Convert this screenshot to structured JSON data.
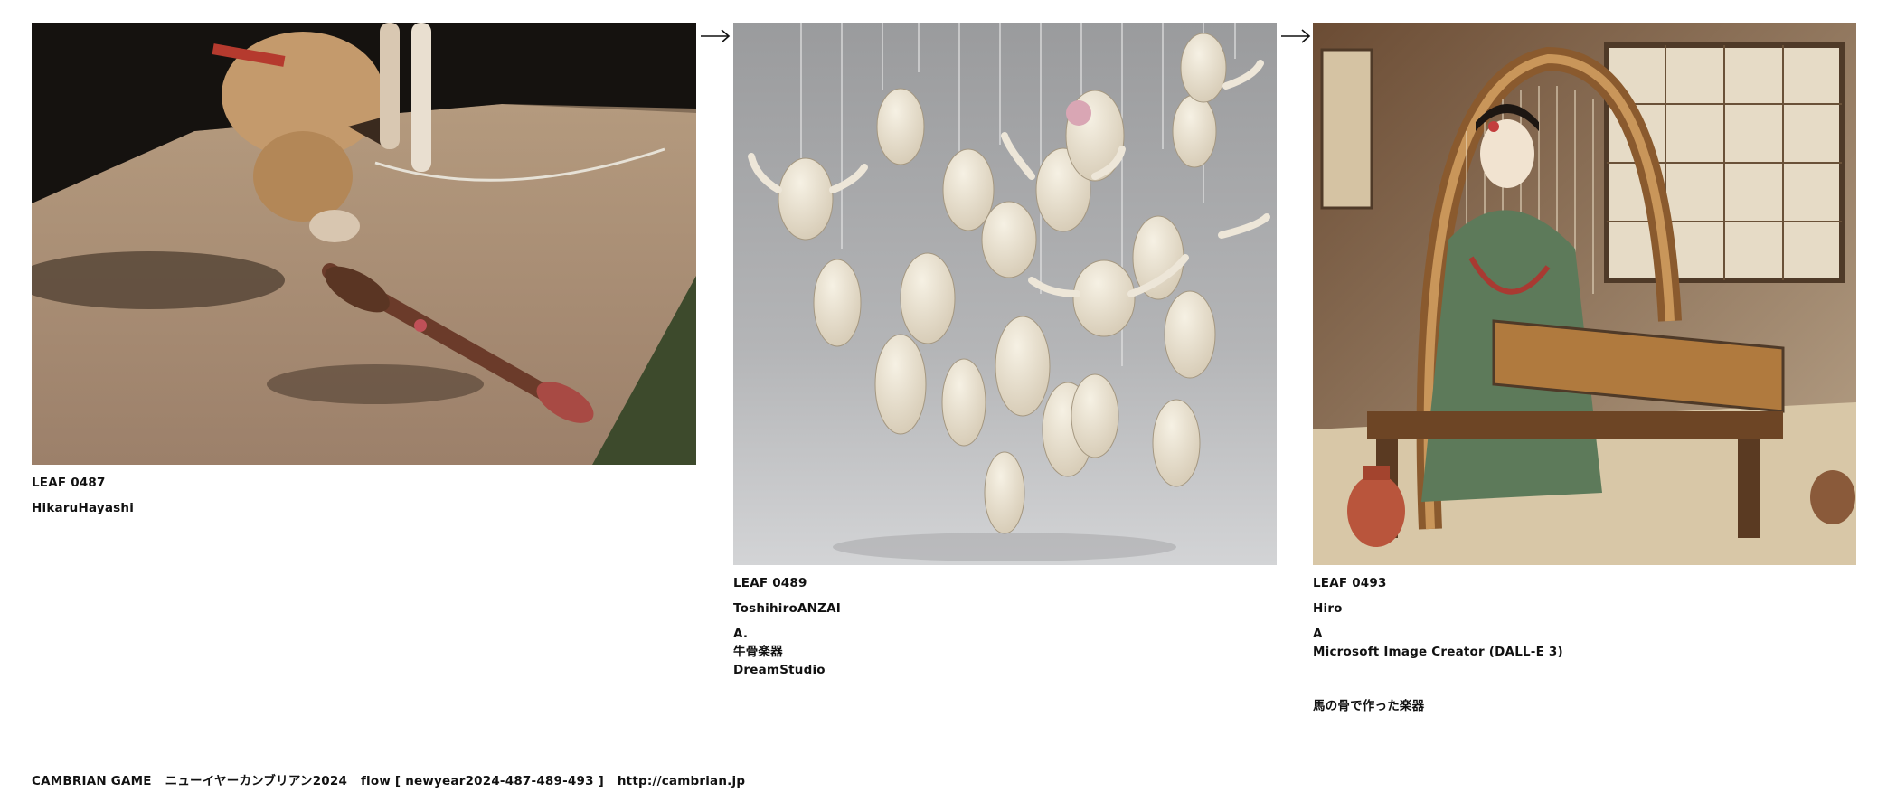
{
  "leaves": [
    {
      "id": "LEAF 0487",
      "author": "HikaruHayashi",
      "image": "photo-dog-sniffing-bone"
    },
    {
      "id": "LEAF 0489",
      "author": "ToshihiroANZAI",
      "title_lines": [
        "A.",
        "牛骨楽器",
        "DreamStudio"
      ],
      "image": "render-hanging-cow-skulls"
    },
    {
      "id": "LEAF 0493",
      "author": "Hiro",
      "title_lines": [
        "A",
        "Microsoft Image Creator (DALL-E 3)"
      ],
      "description": "馬の骨で作った楽器",
      "image": "illustration-woman-playing-harp-instrument"
    }
  ],
  "arrows": [
    "arrow-right-icon",
    "arrow-right-icon"
  ],
  "footer": {
    "game": "CAMBRIAN GAME",
    "event": "ニューイヤーカンブリアン2024",
    "flow": "flow [ newyear2024-487-489-493 ]",
    "url": "http://cambrian.jp"
  },
  "colors": {
    "background": "#ffffff",
    "text": "#111111"
  }
}
